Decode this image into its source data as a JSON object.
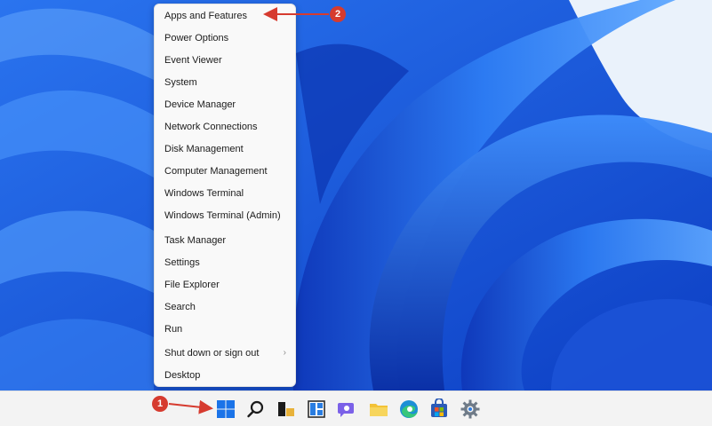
{
  "context_menu": {
    "items": [
      {
        "label": "Apps and Features"
      },
      {
        "label": "Power Options"
      },
      {
        "label": "Event Viewer"
      },
      {
        "label": "System"
      },
      {
        "label": "Device Manager"
      },
      {
        "label": "Network Connections"
      },
      {
        "label": "Disk Management"
      },
      {
        "label": "Computer Management"
      },
      {
        "label": "Windows Terminal"
      },
      {
        "label": "Windows Terminal (Admin)"
      },
      {
        "label": "Task Manager"
      },
      {
        "label": "Settings"
      },
      {
        "label": "File Explorer"
      },
      {
        "label": "Search"
      },
      {
        "label": "Run"
      },
      {
        "label": "Shut down or sign out",
        "submenu_glyph": "›"
      },
      {
        "label": "Desktop"
      }
    ]
  },
  "annotations": {
    "step1": "1",
    "step2": "2",
    "color": "#d63b2f"
  },
  "taskbar": {
    "icons": [
      "start-icon",
      "search-icon",
      "widgets-icon",
      "task-view-icon",
      "chat-icon",
      "file-explorer-icon",
      "edge-icon",
      "store-icon",
      "settings-icon"
    ]
  },
  "colors": {
    "wallpaper_blue": "#1f5fe0",
    "wallpaper_light": "#eaf2fb",
    "menu_bg": "#f9f9f9"
  }
}
